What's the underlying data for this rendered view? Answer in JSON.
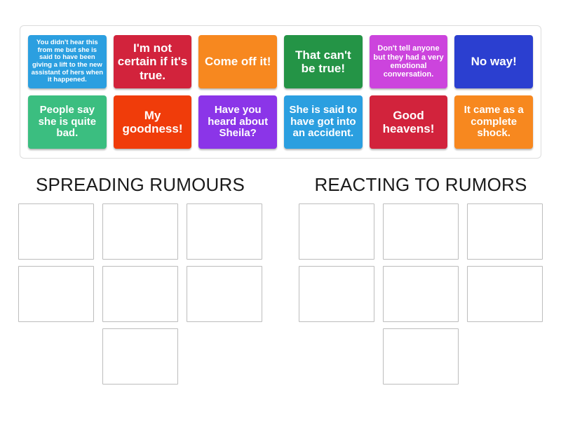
{
  "activity": {
    "type": "group-sort",
    "tray_border_color": "#dcdcdc"
  },
  "tiles": [
    {
      "id": "tile-1",
      "text": "You didn't hear this from me but she is said to have been giving a lift to the new assistant of hers when it happened.",
      "color": "#2B9FE0",
      "size": "fs-tiny"
    },
    {
      "id": "tile-2",
      "text": "I'm not certain if it's true.",
      "color": "#D2233C",
      "size": "fs-large"
    },
    {
      "id": "tile-3",
      "text": "Come off it!",
      "color": "#F7881F",
      "size": "fs-large"
    },
    {
      "id": "tile-4",
      "text": "That can't be true!",
      "color": "#249446",
      "size": "fs-large"
    },
    {
      "id": "tile-5",
      "text": "Don't tell anyone but they had a very emotional conversation.",
      "color": "#CC44DD",
      "size": "fs-small"
    },
    {
      "id": "tile-6",
      "text": "No way!",
      "color": "#2B3FD0",
      "size": "fs-large"
    },
    {
      "id": "tile-7",
      "text": "People say she is quite bad.",
      "color": "#3BBE80",
      "size": "fs-med"
    },
    {
      "id": "tile-8",
      "text": "My goodness!",
      "color": "#F03C0A",
      "size": "fs-large"
    },
    {
      "id": "tile-9",
      "text": "Have you heard about Sheila?",
      "color": "#8B35E8",
      "size": "fs-med"
    },
    {
      "id": "tile-10",
      "text": "She is said to have got into an accident.",
      "color": "#2B9FE0",
      "size": "fs-med"
    },
    {
      "id": "tile-11",
      "text": "Good heavens!",
      "color": "#D2233C",
      "size": "fs-large"
    },
    {
      "id": "tile-12",
      "text": "It came as a complete shock.",
      "color": "#F7881F",
      "size": "fs-med"
    }
  ],
  "categories": [
    {
      "id": "category-left",
      "heading": "SPREADING RUMOURS",
      "slot_rows": [
        3,
        3,
        1
      ],
      "slot_count": 7
    },
    {
      "id": "category-right",
      "heading": "REACTING TO RUMORS",
      "slot_rows": [
        3,
        3,
        1
      ],
      "slot_count": 7
    }
  ]
}
